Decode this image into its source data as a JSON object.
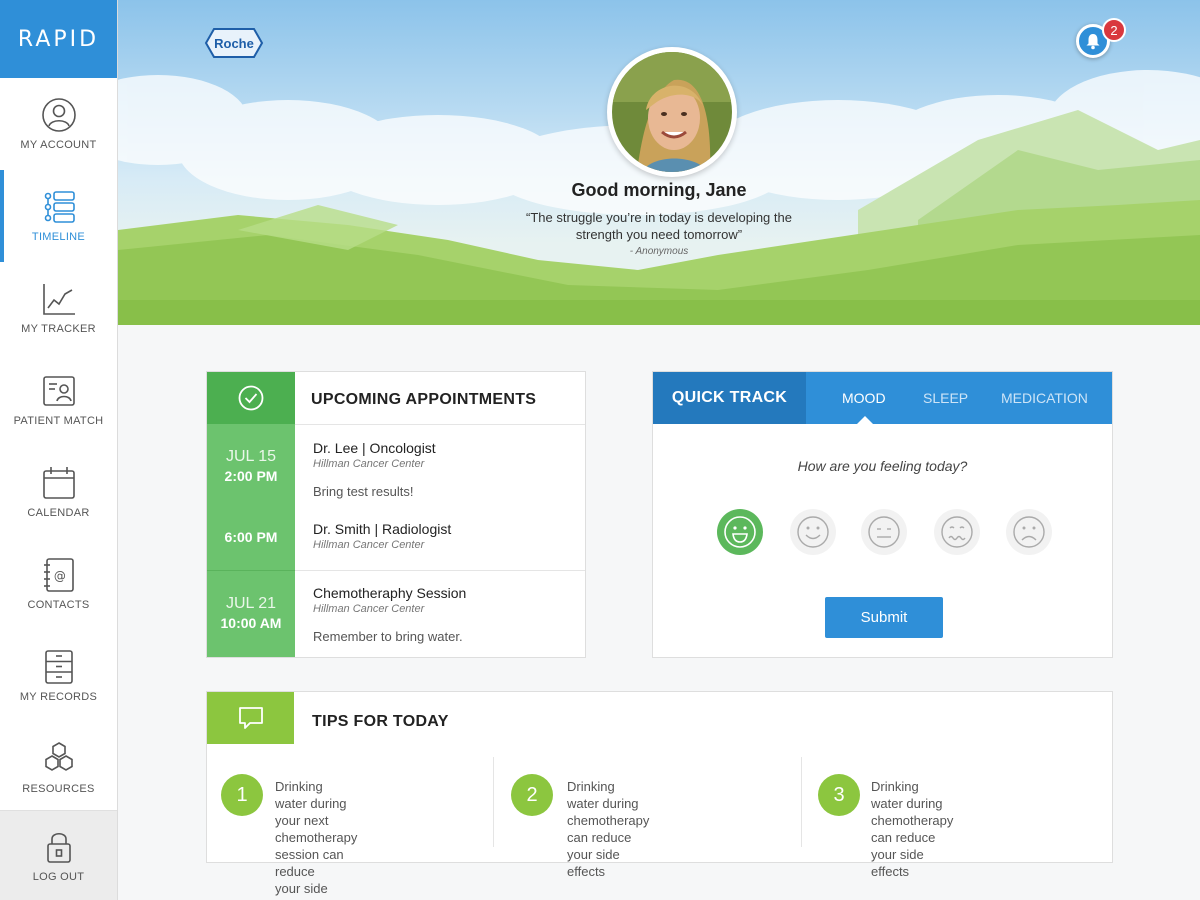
{
  "sidebar": {
    "logo": "RAPID",
    "items": [
      {
        "label": "MY ACCOUNT",
        "icon": "account-icon"
      },
      {
        "label": "TIMELINE",
        "icon": "timeline-icon",
        "active": true
      },
      {
        "label": "MY TRACKER",
        "icon": "tracker-icon"
      },
      {
        "label": "PATIENT MATCH",
        "icon": "patient-match-icon"
      },
      {
        "label": "CALENDAR",
        "icon": "calendar-icon"
      },
      {
        "label": "CONTACTS",
        "icon": "contacts-icon"
      },
      {
        "label": "MY RECORDS",
        "icon": "records-icon"
      },
      {
        "label": "RESOURCES",
        "icon": "resources-icon"
      }
    ],
    "logout": {
      "label": "LOG OUT",
      "icon": "lock-icon"
    }
  },
  "hero": {
    "brand": "Roche",
    "notifications": "2",
    "greeting": "Good morning, Jane",
    "quote_line1": "“The struggle you’re in today is developing the",
    "quote_line2": "strength you need tomorrow”",
    "author": "- Anonymous"
  },
  "appointments": {
    "title": "UPCOMING APPOINTMENTS",
    "groups": [
      {
        "date": "JUL 15",
        "time": "2:00 PM",
        "who": "Dr. Lee  |  Oncologist",
        "location": "Hillman Cancer Center",
        "note": "Bring test results!"
      },
      {
        "date": "",
        "time": "6:00 PM",
        "who": "Dr. Smith  |  Radiologist",
        "location": "Hillman Cancer Center",
        "note": ""
      },
      {
        "date": "JUL 21",
        "time": "10:00 AM",
        "who": "Chemotheraphy Session",
        "location": "Hillman Cancer Center",
        "note": "Remember to bring water."
      }
    ]
  },
  "quick_track": {
    "title": "QUICK TRACK",
    "tabs": [
      "MOOD",
      "SLEEP",
      "MEDICATION"
    ],
    "active_tab": "MOOD",
    "question": "How are you feeling today?",
    "faces": [
      "very-happy-face-icon",
      "happy-face-icon",
      "neutral-face-icon",
      "uneasy-face-icon",
      "sad-face-icon"
    ],
    "selected_face": "very-happy-face-icon",
    "submit": "Submit",
    "colors": {
      "primary": "#2f8fd8",
      "selected": "#5cb85c"
    }
  },
  "tips": {
    "title": "TIPS FOR TODAY",
    "items": [
      {
        "num": "1",
        "lines": [
          "Drinking water during your  next",
          "chemotherapy session can reduce",
          "your side effects"
        ]
      },
      {
        "num": "2",
        "lines": [
          "Drinking water during chemotherapy",
          "can reduce your side effects"
        ]
      },
      {
        "num": "3",
        "lines": [
          "Drinking water during chemotherapy",
          "can reduce your side effects"
        ]
      }
    ]
  }
}
